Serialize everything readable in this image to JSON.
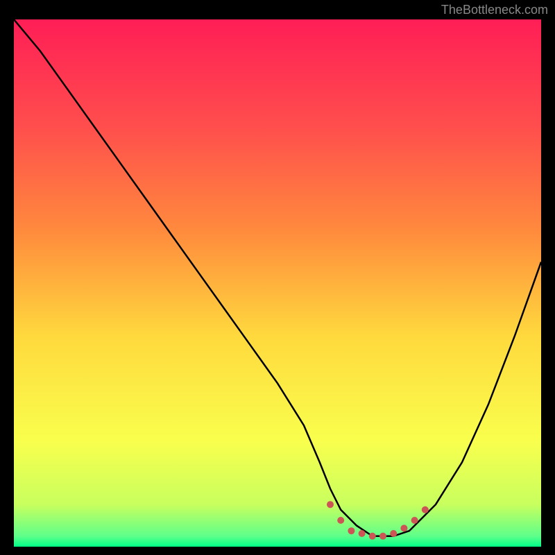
{
  "watermark": "TheBottleneck.com",
  "chart_data": {
    "type": "line",
    "title": "",
    "xlabel": "",
    "ylabel": "",
    "xlim": [
      0,
      100
    ],
    "ylim": [
      0,
      100
    ],
    "series": [
      {
        "name": "bottleneck-curve",
        "x": [
          0,
          5,
          10,
          15,
          20,
          25,
          30,
          35,
          40,
          45,
          50,
          55,
          58,
          60,
          62,
          65,
          68,
          70,
          72,
          75,
          80,
          85,
          90,
          95,
          100
        ],
        "y": [
          100,
          94,
          87,
          80,
          73,
          66,
          59,
          52,
          45,
          38,
          31,
          23,
          16,
          11,
          7,
          4,
          2,
          2,
          2,
          3,
          8,
          16,
          27,
          40,
          54
        ]
      }
    ],
    "markers": {
      "name": "optimal-range",
      "color": "#cc5555",
      "points": [
        {
          "x": 60,
          "y": 8
        },
        {
          "x": 62,
          "y": 5
        },
        {
          "x": 64,
          "y": 3
        },
        {
          "x": 66,
          "y": 2.5
        },
        {
          "x": 68,
          "y": 2
        },
        {
          "x": 70,
          "y": 2
        },
        {
          "x": 72,
          "y": 2.5
        },
        {
          "x": 74,
          "y": 3.5
        },
        {
          "x": 76,
          "y": 5
        },
        {
          "x": 78,
          "y": 7
        }
      ]
    },
    "gradient_stops": [
      {
        "offset": 0,
        "color": "#ff1e56"
      },
      {
        "offset": 20,
        "color": "#ff4d4d"
      },
      {
        "offset": 40,
        "color": "#ff8a3d"
      },
      {
        "offset": 60,
        "color": "#ffd93d"
      },
      {
        "offset": 80,
        "color": "#f9ff4d"
      },
      {
        "offset": 92,
        "color": "#c8ff5e"
      },
      {
        "offset": 98,
        "color": "#5eff8a"
      },
      {
        "offset": 100,
        "color": "#00ff88"
      }
    ]
  }
}
